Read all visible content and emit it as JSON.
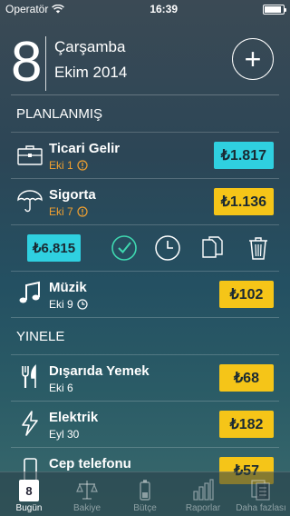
{
  "status": {
    "carrier": "Operatör",
    "time": "16:39",
    "battery_level": 0.9
  },
  "header": {
    "day": "8",
    "weekday": "Çarşamba",
    "month_year": "Ekim 2014",
    "add_label": "+"
  },
  "planned": {
    "title": "PLANLANMIŞ",
    "items": [
      {
        "name": "Ticari Gelir",
        "date": "Eki 1",
        "amount": "₺1.817",
        "color": "#2fd0e0",
        "icon": "briefcase-icon",
        "date_icon": "alert-icon"
      },
      {
        "name": "Sigorta",
        "date": "Eki 7",
        "amount": "₺1.136",
        "color": "#f5c518",
        "icon": "umbrella-icon",
        "date_icon": "alert-icon"
      }
    ],
    "total": "₺6.815",
    "after": [
      {
        "name": "Müzik",
        "date": "Eki 9",
        "amount": "₺102",
        "color": "#f5c518",
        "icon": "music-icon",
        "date_icon": "clock-icon"
      }
    ]
  },
  "repeat": {
    "title": "YINELE",
    "items": [
      {
        "name": "Dışarıda Yemek",
        "date": "Eki 6",
        "amount": "₺68",
        "color": "#f5c518",
        "icon": "fork-knife-icon"
      },
      {
        "name": "Elektrik",
        "date": "Eyl 30",
        "amount": "₺182",
        "color": "#f5c518",
        "icon": "lightning-icon"
      },
      {
        "name": "Cep telefonu",
        "date": "",
        "amount": "₺57",
        "color": "#f5c518",
        "icon": "phone-icon"
      }
    ]
  },
  "tabs": [
    {
      "label": "Bugün",
      "icon_text": "8",
      "icon": "calendar-icon"
    },
    {
      "label": "Bakiye",
      "icon": "scale-icon"
    },
    {
      "label": "Bütçe",
      "icon": "battery-icon"
    },
    {
      "label": "Raporlar",
      "icon": "bar-chart-icon"
    },
    {
      "label": "Daha fazlası",
      "icon": "documents-icon"
    }
  ]
}
